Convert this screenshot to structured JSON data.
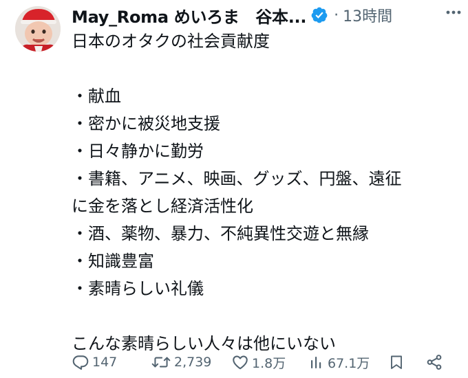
{
  "tweet": {
    "author": {
      "display_name": "May_Roma めいろま　谷本...",
      "avatar_icon": "baby-avatar",
      "verified_icon": "verified-badge-icon",
      "verified_color": "#1d9bf0"
    },
    "separator": "·",
    "time": "13時間",
    "text": "日本のオタクの社会貢献度\n\n・献血\n・密かに被災地支援\n・日々静かに勤労\n・書籍、アニメ、映画、グッズ、円盤、遠征\nに金を落とし経済活性化\n・酒、薬物、暴力、不純異性交遊と無縁\n・知識豊富\n・素晴らしい礼儀\n\nこんな素晴らしい人々は他にいない",
    "stats": {
      "replies": "147",
      "retweets": "2,739",
      "likes": "1.8万",
      "views": "67.1万"
    }
  },
  "colors": {
    "text": "#0f1419",
    "secondary": "#536471",
    "accent": "#1d9bf0"
  },
  "icons": {
    "more": "more-options-icon",
    "reply": "reply-icon",
    "retweet": "retweet-icon",
    "like": "like-icon",
    "views": "views-icon",
    "bookmark": "bookmark-icon",
    "share": "share-icon"
  }
}
